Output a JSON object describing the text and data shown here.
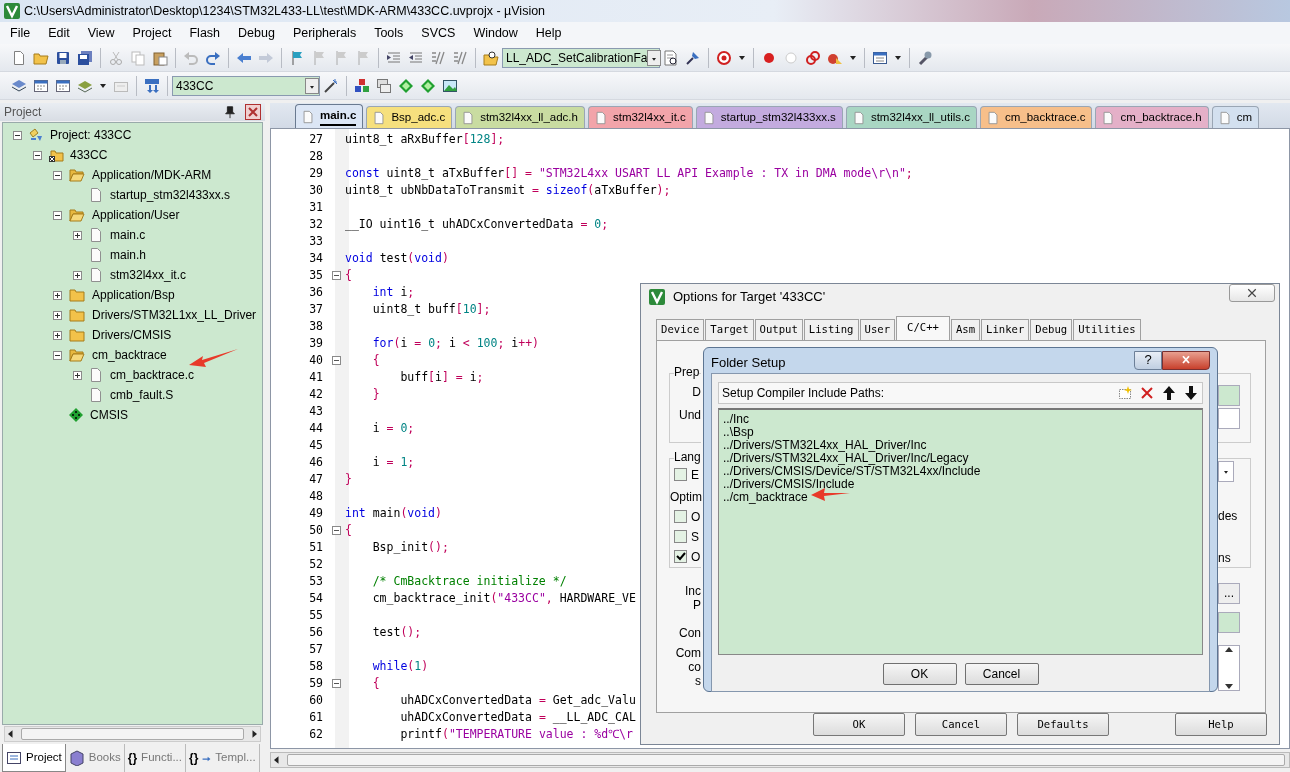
{
  "window": {
    "title": "C:\\Users\\Administrator\\Desktop\\1234\\STM32L433-LL\\test\\MDK-ARM\\433CC.uvprojx - µVision"
  },
  "menu": [
    "File",
    "Edit",
    "View",
    "Project",
    "Flash",
    "Debug",
    "Peripherals",
    "Tools",
    "SVCS",
    "Window",
    "Help"
  ],
  "toolbar": {
    "function_combo": "LL_ADC_SetCalibrationFa",
    "target_combo": "433CC"
  },
  "project_panel": {
    "title": "Project",
    "tree": [
      {
        "label": "Project: 433CC",
        "kind": "project",
        "expanded": true,
        "children": [
          {
            "label": "433CC",
            "kind": "target",
            "expanded": true,
            "children": [
              {
                "label": "Application/MDK-ARM",
                "kind": "folder",
                "expanded": true,
                "children": [
                  {
                    "label": "startup_stm32l433xx.s",
                    "kind": "file"
                  }
                ]
              },
              {
                "label": "Application/User",
                "kind": "folder",
                "expanded": true,
                "children": [
                  {
                    "label": "main.c",
                    "kind": "file",
                    "expanded": false
                  },
                  {
                    "label": "main.h",
                    "kind": "file"
                  },
                  {
                    "label": "stm32l4xx_it.c",
                    "kind": "file",
                    "expanded": false
                  }
                ]
              },
              {
                "label": "Application/Bsp",
                "kind": "folder",
                "expanded": false
              },
              {
                "label": "Drivers/STM32L1xx_LL_Driver",
                "kind": "folder",
                "expanded": false
              },
              {
                "label": "Drivers/CMSIS",
                "kind": "folder",
                "expanded": false
              },
              {
                "label": "cm_backtrace",
                "kind": "folder",
                "expanded": true,
                "children": [
                  {
                    "label": "cm_backtrace.c",
                    "kind": "file",
                    "expanded": false
                  },
                  {
                    "label": "cmb_fault.S",
                    "kind": "file"
                  }
                ]
              },
              {
                "label": "CMSIS",
                "kind": "component"
              }
            ]
          }
        ]
      }
    ],
    "tabs": [
      {
        "label": "Project",
        "selected": true
      },
      {
        "label": "Books",
        "selected": false
      },
      {
        "label": "Functi...",
        "icon_text": "{}",
        "selected": false
      },
      {
        "label": "Templ...",
        "icon_text": "{}",
        "selected": false
      }
    ]
  },
  "editor": {
    "tabs": [
      {
        "label": "main.c",
        "color": "#dce6f5",
        "selected": true
      },
      {
        "label": "Bsp_adc.c",
        "color": "#f6e07e",
        "selected": false
      },
      {
        "label": "stm32l4xx_ll_adc.h",
        "color": "#c9dca1",
        "selected": false
      },
      {
        "label": "stm32l4xx_it.c",
        "color": "#f2a4aa",
        "selected": false
      },
      {
        "label": "startup_stm32l433xx.s",
        "color": "#c3abdf",
        "selected": false
      },
      {
        "label": "stm32l4xx_ll_utils.c",
        "color": "#a9d6c3",
        "selected": false
      },
      {
        "label": "cm_backtrace.c",
        "color": "#f7bf8a",
        "selected": false
      },
      {
        "label": "cm_backtrace.h",
        "color": "#e4b0c8",
        "selected": false
      },
      {
        "label": "cm",
        "color": "#d3e0ef",
        "selected": false
      }
    ],
    "lines": [
      {
        "number": "27",
        "foldable": false,
        "tokens": [
          {
            "kind": "plain",
            "text": "uint8_t aRxBuffer"
          },
          {
            "kind": "punct",
            "text": "["
          },
          {
            "kind": "number",
            "text": "128"
          },
          {
            "kind": "punct",
            "text": "];"
          }
        ]
      },
      {
        "number": "28",
        "foldable": false
      },
      {
        "number": "29",
        "foldable": false,
        "tokens": [
          {
            "kind": "keyword",
            "text": "const"
          },
          {
            "kind": "plain",
            "text": " uint8_t aTxBuffer"
          },
          {
            "kind": "punct",
            "text": "[] = "
          },
          {
            "kind": "string",
            "text": "\"STM32L4xx USART LL API Example : TX in DMA mode\\r\\n\""
          },
          {
            "kind": "punct",
            "text": ";"
          }
        ]
      },
      {
        "number": "30",
        "foldable": false,
        "tokens": [
          {
            "kind": "plain",
            "text": "uint8_t ubNbDataToTransmit "
          },
          {
            "kind": "punct",
            "text": "= "
          },
          {
            "kind": "keyword",
            "text": "sizeof"
          },
          {
            "kind": "punct",
            "text": "("
          },
          {
            "kind": "plain",
            "text": "aTxBuffer"
          },
          {
            "kind": "punct",
            "text": ");"
          }
        ]
      },
      {
        "number": "31",
        "foldable": false
      },
      {
        "number": "32",
        "foldable": false,
        "tokens": [
          {
            "kind": "plain",
            "text": "__IO uint16_t uhADCxConvertedData "
          },
          {
            "kind": "punct",
            "text": "= "
          },
          {
            "kind": "number",
            "text": "0"
          },
          {
            "kind": "punct",
            "text": ";"
          }
        ]
      },
      {
        "number": "33",
        "foldable": false
      },
      {
        "number": "34",
        "foldable": false,
        "tokens": [
          {
            "kind": "keyword",
            "text": "void"
          },
          {
            "kind": "plain",
            "text": " test"
          },
          {
            "kind": "punct",
            "text": "("
          },
          {
            "kind": "keyword",
            "text": "void"
          },
          {
            "kind": "punct",
            "text": ")"
          }
        ]
      },
      {
        "number": "35",
        "foldable": true,
        "tokens": [
          {
            "kind": "punct",
            "text": "{"
          }
        ]
      },
      {
        "number": "36",
        "foldable": false,
        "tokens": [
          {
            "kind": "keyword",
            "text": "    int"
          },
          {
            "kind": "plain",
            "text": " i"
          },
          {
            "kind": "punct",
            "text": ";"
          }
        ]
      },
      {
        "number": "37",
        "foldable": false,
        "tokens": [
          {
            "kind": "plain",
            "text": "    uint8_t buff"
          },
          {
            "kind": "punct",
            "text": "["
          },
          {
            "kind": "number",
            "text": "10"
          },
          {
            "kind": "punct",
            "text": "];"
          }
        ]
      },
      {
        "number": "38",
        "foldable": false
      },
      {
        "number": "39",
        "foldable": false,
        "tokens": [
          {
            "kind": "keyword",
            "text": "    for"
          },
          {
            "kind": "punct",
            "text": "("
          },
          {
            "kind": "plain",
            "text": "i "
          },
          {
            "kind": "punct",
            "text": "= "
          },
          {
            "kind": "number",
            "text": "0"
          },
          {
            "kind": "punct",
            "text": "; "
          },
          {
            "kind": "plain",
            "text": "i "
          },
          {
            "kind": "punct",
            "text": "< "
          },
          {
            "kind": "number",
            "text": "100"
          },
          {
            "kind": "punct",
            "text": "; "
          },
          {
            "kind": "plain",
            "text": "i"
          },
          {
            "kind": "punct",
            "text": "++)"
          }
        ]
      },
      {
        "number": "40",
        "foldable": true,
        "tokens": [
          {
            "kind": "punct",
            "text": "    {"
          }
        ]
      },
      {
        "number": "41",
        "foldable": false,
        "tokens": [
          {
            "kind": "plain",
            "text": "        buff"
          },
          {
            "kind": "punct",
            "text": "["
          },
          {
            "kind": "plain",
            "text": "i"
          },
          {
            "kind": "punct",
            "text": "] = "
          },
          {
            "kind": "plain",
            "text": "i"
          },
          {
            "kind": "punct",
            "text": ";"
          }
        ]
      },
      {
        "number": "42",
        "foldable": false,
        "tokens": [
          {
            "kind": "punct",
            "text": "    }"
          }
        ]
      },
      {
        "number": "43",
        "foldable": false
      },
      {
        "number": "44",
        "foldable": false,
        "tokens": [
          {
            "kind": "plain",
            "text": "    i "
          },
          {
            "kind": "punct",
            "text": "= "
          },
          {
            "kind": "number",
            "text": "0"
          },
          {
            "kind": "punct",
            "text": ";"
          }
        ]
      },
      {
        "number": "45",
        "foldable": false
      },
      {
        "number": "46",
        "foldable": false,
        "tokens": [
          {
            "kind": "plain",
            "text": "    i "
          },
          {
            "kind": "punct",
            "text": "= "
          },
          {
            "kind": "number",
            "text": "1"
          },
          {
            "kind": "punct",
            "text": ";"
          }
        ]
      },
      {
        "number": "47",
        "foldable": false,
        "tokens": [
          {
            "kind": "punct",
            "text": "}"
          }
        ]
      },
      {
        "number": "48",
        "foldable": false
      },
      {
        "number": "49",
        "foldable": false,
        "tokens": [
          {
            "kind": "keyword",
            "text": "int"
          },
          {
            "kind": "plain",
            "text": " main"
          },
          {
            "kind": "punct",
            "text": "("
          },
          {
            "kind": "keyword",
            "text": "void"
          },
          {
            "kind": "punct",
            "text": ")"
          }
        ]
      },
      {
        "number": "50",
        "foldable": true,
        "tokens": [
          {
            "kind": "punct",
            "text": "{"
          }
        ]
      },
      {
        "number": "51",
        "foldable": false,
        "tokens": [
          {
            "kind": "plain",
            "text": "    Bsp_init"
          },
          {
            "kind": "punct",
            "text": "();"
          }
        ]
      },
      {
        "number": "52",
        "foldable": false
      },
      {
        "number": "53",
        "foldable": false,
        "tokens": [
          {
            "kind": "comment",
            "text": "    /* CmBacktrace initialize */"
          }
        ]
      },
      {
        "number": "54",
        "foldable": false,
        "tokens": [
          {
            "kind": "plain",
            "text": "    cm_backtrace_init"
          },
          {
            "kind": "punct",
            "text": "("
          },
          {
            "kind": "string",
            "text": "\"433CC\""
          },
          {
            "kind": "punct",
            "text": ", "
          },
          {
            "kind": "plain",
            "text": "HARDWARE_VE"
          }
        ]
      },
      {
        "number": "55",
        "foldable": false
      },
      {
        "number": "56",
        "foldable": false,
        "tokens": [
          {
            "kind": "plain",
            "text": "    test"
          },
          {
            "kind": "punct",
            "text": "();"
          }
        ]
      },
      {
        "number": "57",
        "foldable": false
      },
      {
        "number": "58",
        "foldable": false,
        "tokens": [
          {
            "kind": "keyword",
            "text": "    while"
          },
          {
            "kind": "punct",
            "text": "("
          },
          {
            "kind": "number",
            "text": "1"
          },
          {
            "kind": "punct",
            "text": ")"
          }
        ]
      },
      {
        "number": "59",
        "foldable": true,
        "tokens": [
          {
            "kind": "punct",
            "text": "    {"
          }
        ]
      },
      {
        "number": "60",
        "foldable": false,
        "tokens": [
          {
            "kind": "plain",
            "text": "        uhADCxConvertedData "
          },
          {
            "kind": "punct",
            "text": "= "
          },
          {
            "kind": "plain",
            "text": "Get_adc_Valu"
          }
        ]
      },
      {
        "number": "61",
        "foldable": false,
        "tokens": [
          {
            "kind": "plain",
            "text": "        uhADCxConvertedData "
          },
          {
            "kind": "punct",
            "text": "= "
          },
          {
            "kind": "plain",
            "text": "__LL_ADC_CAL"
          }
        ]
      },
      {
        "number": "62",
        "foldable": false,
        "tokens": [
          {
            "kind": "plain",
            "text": "        printf"
          },
          {
            "kind": "punct",
            "text": "("
          },
          {
            "kind": "string",
            "text": "\"TEMPERATURE value : %d℃\\r"
          }
        ]
      }
    ]
  },
  "options_dialog": {
    "title": "Options for Target '433CC'",
    "tabs": [
      {
        "label": "Device",
        "selected": false
      },
      {
        "label": "Target",
        "selected": false
      },
      {
        "label": "Output",
        "selected": false
      },
      {
        "label": "Listing",
        "selected": false
      },
      {
        "label": "User",
        "selected": false
      },
      {
        "label": "C/C++",
        "selected": true
      },
      {
        "label": "Asm",
        "selected": false
      },
      {
        "label": "Linker",
        "selected": false
      },
      {
        "label": "Debug",
        "selected": false
      },
      {
        "label": "Utilities",
        "selected": false
      }
    ],
    "left": {
      "preprocessor_group": {
        "label": "Prep",
        "rows": [
          "D",
          "Und"
        ]
      },
      "language_group": {
        "label": "Lang",
        "checkbox": {
          "label": "E",
          "checked": false
        },
        "subtitle": "Optim",
        "checkboxes": [
          {
            "label": "O",
            "checked": false
          },
          {
            "label": "S",
            "checked": false
          },
          {
            "label": "O",
            "checked": true
          }
        ]
      },
      "labels": [
        [
          "Inc",
          "P"
        ],
        [
          "Con"
        ],
        [
          "Com",
          "co",
          "s"
        ]
      ]
    },
    "right": {
      "texts": [
        "des",
        "ns"
      ],
      "browse_button": "..."
    },
    "buttons": [
      "OK",
      "Cancel",
      "Defaults",
      "Help"
    ]
  },
  "folder_dialog": {
    "title": "Folder Setup",
    "help_button": "?",
    "heading": "Setup Compiler Include Paths:",
    "paths": [
      "../Inc",
      "..\\Bsp",
      "../Drivers/STM32L4xx_HAL_Driver/Inc",
      "../Drivers/STM32L4xx_HAL_Driver/Inc/Legacy",
      "../Drivers/CMSIS/Device/ST/STM32L4xx/Include",
      "../Drivers/CMSIS/Include",
      "../cm_backtrace"
    ],
    "buttons": [
      "OK",
      "Cancel"
    ]
  }
}
